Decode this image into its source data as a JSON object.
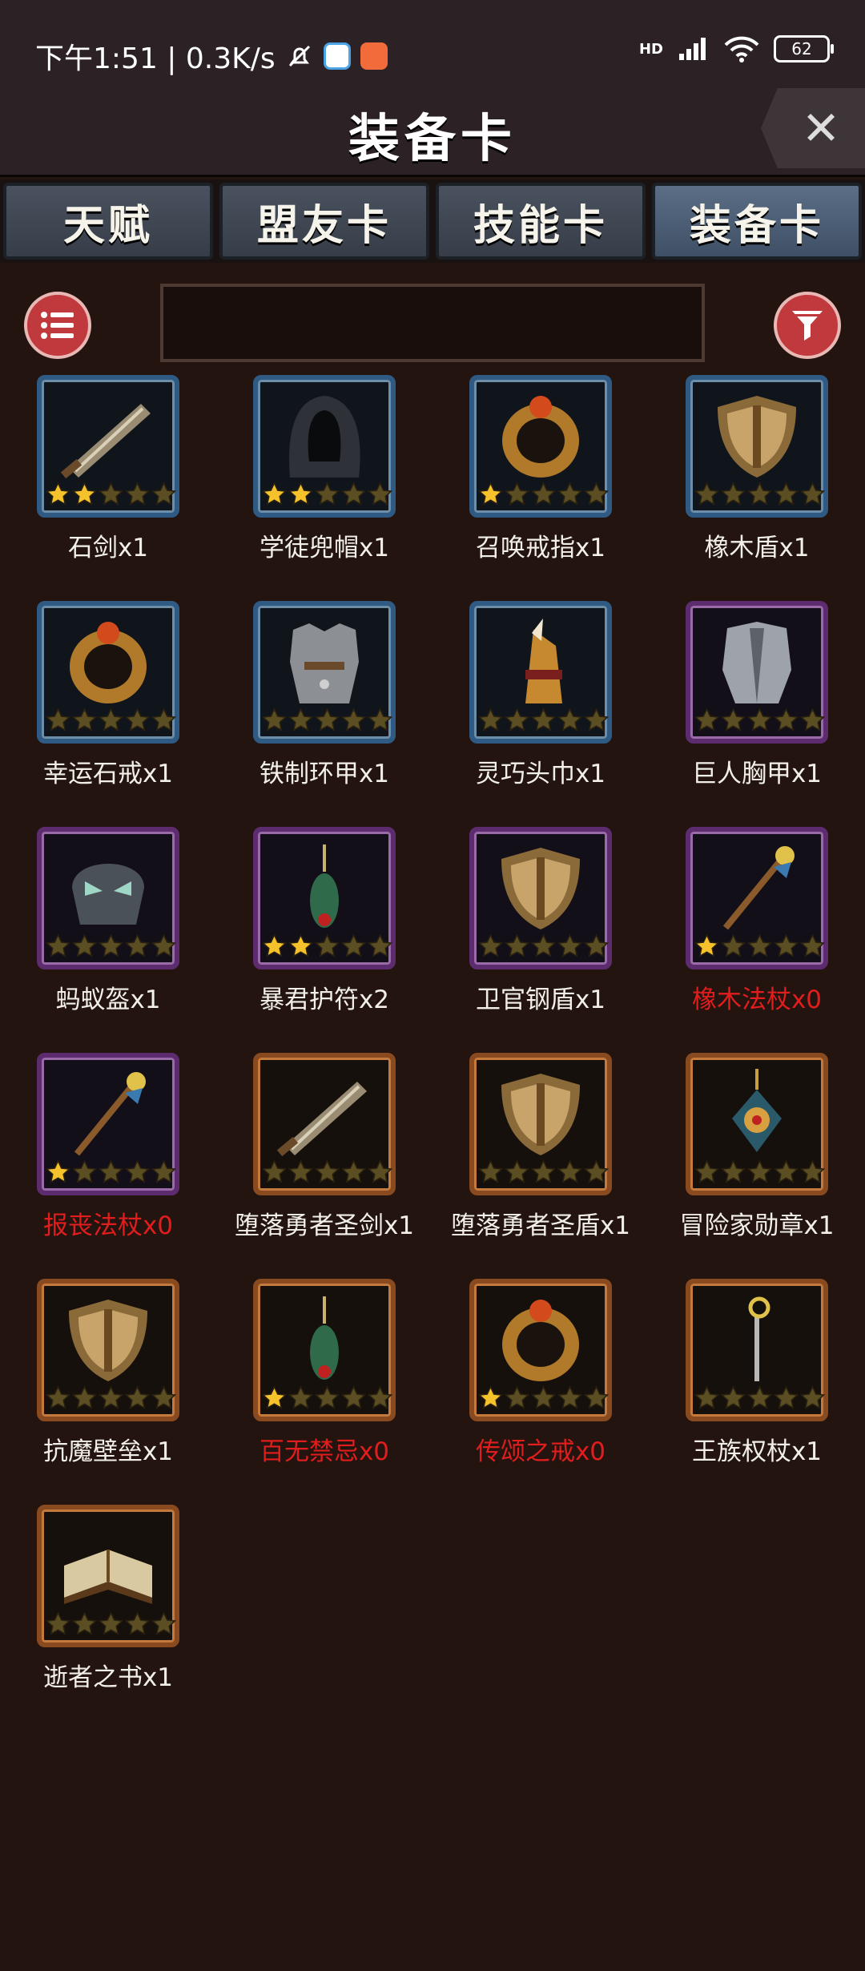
{
  "status": {
    "time_speed": "下午1:51 | 0.3K/s",
    "network": "HD",
    "battery": "62"
  },
  "title": "装备卡",
  "close_glyph": "✕",
  "tabs": [
    {
      "label": "天赋",
      "active": false
    },
    {
      "label": "盟友卡",
      "active": false
    },
    {
      "label": "技能卡",
      "active": false
    },
    {
      "label": "装备卡",
      "active": true
    }
  ],
  "search": {
    "value": ""
  },
  "cards": [
    {
      "label": "石剑x1",
      "stars": 2,
      "rarity": "blue",
      "icon": "sword-icon"
    },
    {
      "label": "学徒兜帽x1",
      "stars": 2,
      "rarity": "blue",
      "icon": "hood-icon"
    },
    {
      "label": "召唤戒指x1",
      "stars": 1,
      "rarity": "blue",
      "icon": "ring-icon"
    },
    {
      "label": "橡木盾x1",
      "stars": 0,
      "rarity": "blue",
      "icon": "shield-icon"
    },
    {
      "label": "幸运石戒x1",
      "stars": 0,
      "rarity": "blue",
      "icon": "ring-icon"
    },
    {
      "label": "铁制环甲x1",
      "stars": 0,
      "rarity": "blue",
      "icon": "armor-icon"
    },
    {
      "label": "灵巧头巾x1",
      "stars": 0,
      "rarity": "blue",
      "icon": "headscarf-icon"
    },
    {
      "label": "巨人胸甲x1",
      "stars": 0,
      "rarity": "purple",
      "icon": "chestplate-icon"
    },
    {
      "label": "蚂蚁盔x1",
      "stars": 0,
      "rarity": "purple",
      "icon": "helmet-icon"
    },
    {
      "label": "暴君护符x2",
      "stars": 2,
      "rarity": "purple",
      "icon": "amulet-icon"
    },
    {
      "label": "卫官钢盾x1",
      "stars": 0,
      "rarity": "purple",
      "icon": "shield-icon"
    },
    {
      "label": "橡木法杖x0",
      "stars": 1,
      "rarity": "purple",
      "icon": "staff-icon"
    },
    {
      "label": "报丧法杖x0",
      "stars": 1,
      "rarity": "purple",
      "icon": "staff-icon"
    },
    {
      "label": "堕落勇者圣剑x1",
      "stars": 0,
      "rarity": "orange",
      "icon": "sword-icon"
    },
    {
      "label": "堕落勇者圣盾x1",
      "stars": 0,
      "rarity": "orange",
      "icon": "shield-icon"
    },
    {
      "label": "冒险家勋章x1",
      "stars": 0,
      "rarity": "orange",
      "icon": "medal-icon"
    },
    {
      "label": "抗魔壁垒x1",
      "stars": 0,
      "rarity": "orange",
      "icon": "shield-icon"
    },
    {
      "label": "百无禁忌x0",
      "stars": 1,
      "rarity": "orange",
      "icon": "amulet-icon"
    },
    {
      "label": "传颂之戒x0",
      "stars": 1,
      "rarity": "orange",
      "icon": "ring-icon"
    },
    {
      "label": "王族权杖x1",
      "stars": 0,
      "rarity": "orange",
      "icon": "scepter-icon"
    },
    {
      "label": "逝者之书x1",
      "stars": 0,
      "rarity": "orange",
      "icon": "book-icon"
    }
  ],
  "colors": {
    "background": "#231410",
    "zero_count": "#e11d1d",
    "star_filled": "#f5c22b",
    "star_empty": "#5a4e22",
    "button_red": "#c0393d"
  }
}
